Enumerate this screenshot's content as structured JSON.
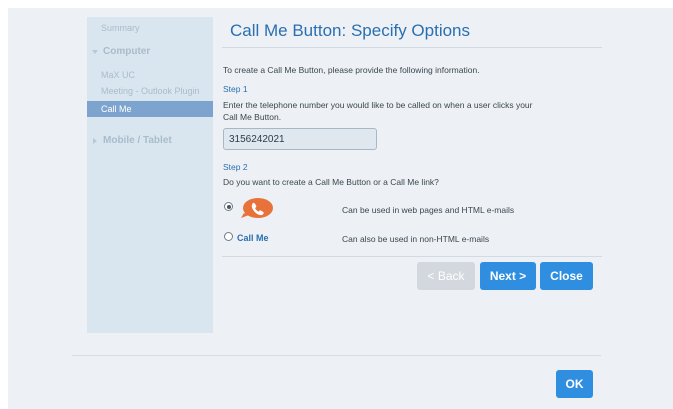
{
  "sidebar": {
    "items": [
      {
        "label": "Summary"
      },
      {
        "label": "Computer"
      },
      {
        "label": "MaX UC"
      },
      {
        "label": "Meeting - Outlook Plugin"
      },
      {
        "label": "Call Me"
      },
      {
        "label": "Mobile / Tablet"
      }
    ]
  },
  "main": {
    "title": "Call Me Button: Specify Options",
    "intro": "To create a Call Me Button, please provide the following information.",
    "step1": {
      "label": "Step 1",
      "line1": "Enter the telephone number you would like to be called on when a user clicks your",
      "line2": "Call Me Button.",
      "phone_value": "3156242021"
    },
    "step2": {
      "label": "Step 2",
      "question": "Do you want to create a Call Me Button or a Call Me link?",
      "option_button_desc": "Can be used in web pages and HTML e-mails",
      "option_link_label": "Call Me",
      "option_link_desc": "Can also be used in non-HTML e-mails"
    }
  },
  "buttons": {
    "back": "< Back",
    "next": "Next >",
    "close": "Close",
    "ok": "OK"
  },
  "colors": {
    "accent": "#2f8ee0",
    "title": "#2a6fb0",
    "bubble": "#e8733a"
  },
  "icons": {
    "phone": "phone-icon"
  }
}
